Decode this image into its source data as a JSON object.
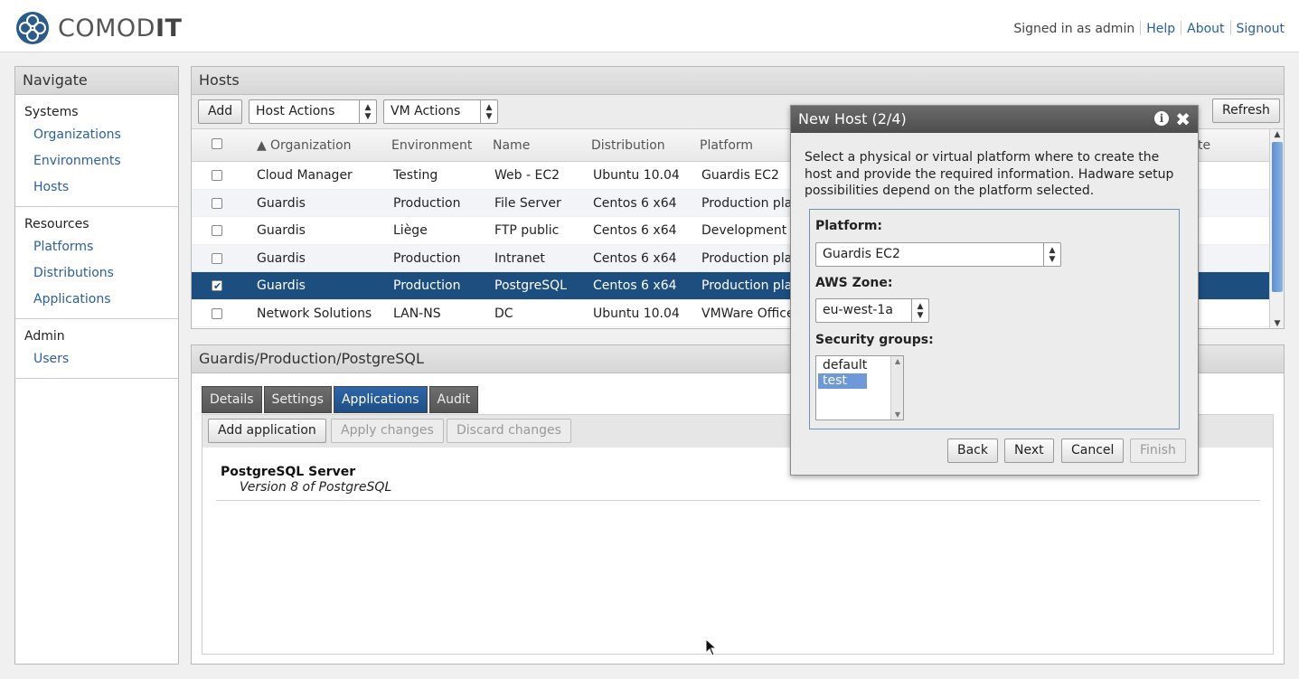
{
  "header": {
    "logo_text_light": "COMOD",
    "logo_text_bold": "IT",
    "signed_in": "Signed in as admin",
    "links": [
      "Help",
      "About",
      "Signout"
    ]
  },
  "nav": {
    "title": "Navigate",
    "sections": [
      {
        "title": "Systems",
        "items": [
          "Organizations",
          "Environments",
          "Hosts"
        ]
      },
      {
        "title": "Resources",
        "items": [
          "Platforms",
          "Distributions",
          "Applications"
        ]
      },
      {
        "title": "Admin",
        "items": [
          "Users"
        ]
      }
    ]
  },
  "hosts": {
    "title": "Hosts",
    "add_label": "Add",
    "host_actions": "Host Actions",
    "vm_actions": "VM Actions",
    "refresh_label": "Refresh",
    "columns": [
      "Organization",
      "Environment",
      "Name",
      "Distribution",
      "Platform",
      "te"
    ],
    "rows": [
      {
        "checked": false,
        "organization": "Cloud Manager",
        "environment": "Testing",
        "name": "Web - EC2",
        "distribution": "Ubuntu 10.04",
        "platform": "Guardis EC2"
      },
      {
        "checked": false,
        "organization": "Guardis",
        "environment": "Production",
        "name": "File Server",
        "distribution": "Centos 6 x64",
        "platform": "Production plat"
      },
      {
        "checked": false,
        "organization": "Guardis",
        "environment": "Liège",
        "name": "FTP public",
        "distribution": "Centos 6 x64",
        "platform": "Development h"
      },
      {
        "checked": false,
        "organization": "Guardis",
        "environment": "Production",
        "name": "Intranet",
        "distribution": "Centos 6 x64",
        "platform": "Production plat"
      },
      {
        "checked": true,
        "organization": "Guardis",
        "environment": "Production",
        "name": "PostgreSQL",
        "distribution": "Centos 6 x64",
        "platform": "Production plat"
      },
      {
        "checked": false,
        "organization": "Network Solutions",
        "environment": "LAN-NS",
        "name": "DC",
        "distribution": "Ubuntu 10.04",
        "platform": "VMWare Office"
      }
    ]
  },
  "details": {
    "title": "Guardis/Production/PostgreSQL",
    "tabs": [
      "Details",
      "Settings",
      "Applications",
      "Audit"
    ],
    "active_tab": "Applications",
    "add_application": "Add application",
    "apply_changes": "Apply changes",
    "discard_changes": "Discard changes",
    "app_name": "PostgreSQL Server",
    "app_desc": "Version 8 of PostgreSQL"
  },
  "dialog": {
    "title": "New Host (2/4)",
    "description": "Select a physical or virtual platform where to create the host and provide the required information. Hadware setup possibilities depend on the platform selected.",
    "platform_label": "Platform:",
    "platform_value": "Guardis EC2",
    "zone_label": "AWS Zone:",
    "zone_value": "eu-west-1a",
    "groups_label": "Security groups:",
    "groups": [
      "default",
      "test"
    ],
    "selected_group": "test",
    "back": "Back",
    "next": "Next",
    "cancel": "Cancel",
    "finish": "Finish"
  },
  "colors": {
    "selected_row": "#1c4f80",
    "link": "#2a5f9e",
    "active_tab": "#2e66a8"
  }
}
